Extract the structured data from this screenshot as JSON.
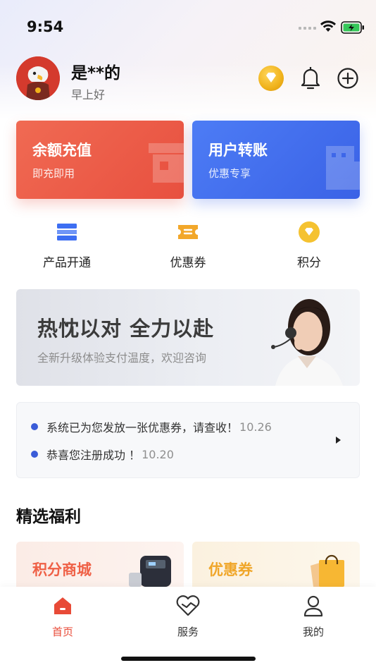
{
  "status_bar": {
    "time": "9:54"
  },
  "header": {
    "user_name": "是**的",
    "greeting": "早上好"
  },
  "cards": [
    {
      "title": "余额充值",
      "subtitle": "即充即用"
    },
    {
      "title": "用户转账",
      "subtitle": "优惠专享"
    }
  ],
  "quick_menu": [
    {
      "label": "产品开通",
      "icon": "card-icon"
    },
    {
      "label": "优惠券",
      "icon": "ticket-icon"
    },
    {
      "label": "积分",
      "icon": "points-icon"
    }
  ],
  "banner": {
    "title": "热忱以对 全力以赴",
    "subtitle": "全新升级体验支付温度，欢迎咨询"
  },
  "notices": [
    {
      "text": "系统已为您发放一张优惠券，请查收！",
      "date": "10.26"
    },
    {
      "text": "恭喜您注册成功 ！",
      "date": "10.20"
    }
  ],
  "section": {
    "title": "精选福利"
  },
  "benefits": [
    {
      "title": "积分商城"
    },
    {
      "title": "优惠券"
    }
  ],
  "tab_bar": [
    {
      "label": "首页",
      "active": true
    },
    {
      "label": "服务",
      "active": false
    },
    {
      "label": "我的",
      "active": false
    }
  ],
  "colors": {
    "accent_red": "#e84a37",
    "accent_blue": "#3a62e6",
    "gold": "#f0b21b",
    "notice_dot": "#3a5cd8"
  }
}
